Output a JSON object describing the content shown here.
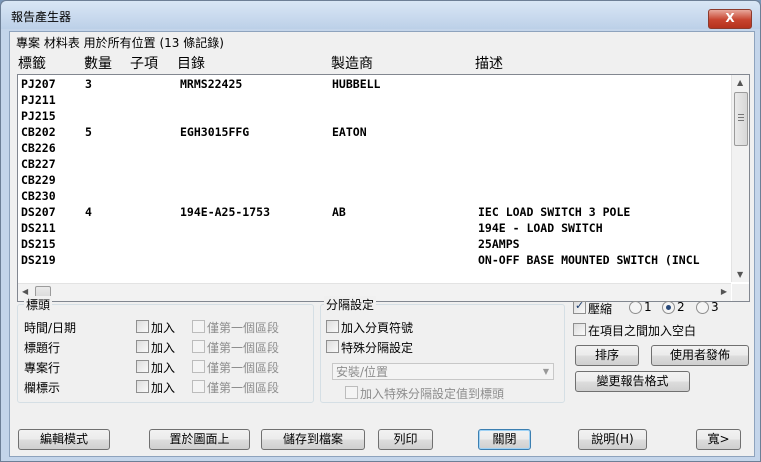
{
  "window": {
    "title": "報告產生器",
    "close_label": "X"
  },
  "info_text": "專案 材料表 用於所有位置 (13 條記錄)",
  "columns": [
    "標籤",
    "數量",
    "子項",
    "目錄",
    "製造商",
    "描述"
  ],
  "rows": [
    {
      "tag": "PJ207",
      "qty": "3",
      "sub": "",
      "catalog": "MRMS22425",
      "mfr": "HUBBELL",
      "desc": ""
    },
    {
      "tag": "PJ211",
      "qty": "",
      "sub": "",
      "catalog": "",
      "mfr": "",
      "desc": ""
    },
    {
      "tag": "PJ215",
      "qty": "",
      "sub": "",
      "catalog": "",
      "mfr": "",
      "desc": ""
    },
    {
      "tag": "CB202",
      "qty": "5",
      "sub": "",
      "catalog": "EGH3015FFG",
      "mfr": "EATON",
      "desc": ""
    },
    {
      "tag": "CB226",
      "qty": "",
      "sub": "",
      "catalog": "",
      "mfr": "",
      "desc": ""
    },
    {
      "tag": "CB227",
      "qty": "",
      "sub": "",
      "catalog": "",
      "mfr": "",
      "desc": ""
    },
    {
      "tag": "CB229",
      "qty": "",
      "sub": "",
      "catalog": "",
      "mfr": "",
      "desc": ""
    },
    {
      "tag": "CB230",
      "qty": "",
      "sub": "",
      "catalog": "",
      "mfr": "",
      "desc": ""
    },
    {
      "tag": "DS207",
      "qty": "4",
      "sub": "",
      "catalog": "194E-A25-1753",
      "mfr": "AB",
      "desc": "IEC LOAD SWITCH 3 POLE"
    },
    {
      "tag": "DS211",
      "qty": "",
      "sub": "",
      "catalog": "",
      "mfr": "",
      "desc": "194E - LOAD SWITCH"
    },
    {
      "tag": "DS215",
      "qty": "",
      "sub": "",
      "catalog": "",
      "mfr": "",
      "desc": "25AMPS"
    },
    {
      "tag": "DS219",
      "qty": "",
      "sub": "",
      "catalog": "",
      "mfr": "",
      "desc": "ON-OFF BASE MOUNTED SWITCH (INCL"
    }
  ],
  "header_group": {
    "title": "標頭",
    "rows": [
      {
        "label": "時間/日期",
        "add": "加入",
        "first_only": "僅第一個區段"
      },
      {
        "label": "標題行",
        "add": "加入",
        "first_only": "僅第一個區段"
      },
      {
        "label": "專案行",
        "add": "加入",
        "first_only": "僅第一個區段"
      },
      {
        "label": "欄標示",
        "add": "加入",
        "first_only": "僅第一個區段"
      }
    ]
  },
  "separator_group": {
    "title": "分隔設定",
    "page_break": "加入分頁符號",
    "special": "特殊分隔設定",
    "select_value": "安裝/位置",
    "add_special_to_header": "加入特殊分隔設定值到標頭"
  },
  "compress": {
    "label": "壓縮",
    "checked": true,
    "options": [
      "1",
      "2",
      "3"
    ],
    "selected": "2"
  },
  "blank_between": "在項目之間加入空白",
  "buttons": {
    "sort": "排序",
    "user_defined": "使用者發佈",
    "change_format": "變更報告格式",
    "edit_mode": "編輯模式",
    "put_on_drawing": "置於圖面上",
    "save_to_file": "儲存到檔案",
    "print": "列印",
    "close": "關閉",
    "help": "說明(H)",
    "wide": "寬>"
  },
  "colors": {
    "title_bar": "#c4d5ea",
    "close_button": "#c7432e",
    "panel": "#f0f0f0"
  },
  "icons": [
    "close-icon",
    "scroll-up-icon",
    "scroll-down-icon",
    "scroll-left-icon",
    "scroll-right-icon",
    "dropdown-arrow-icon"
  ]
}
